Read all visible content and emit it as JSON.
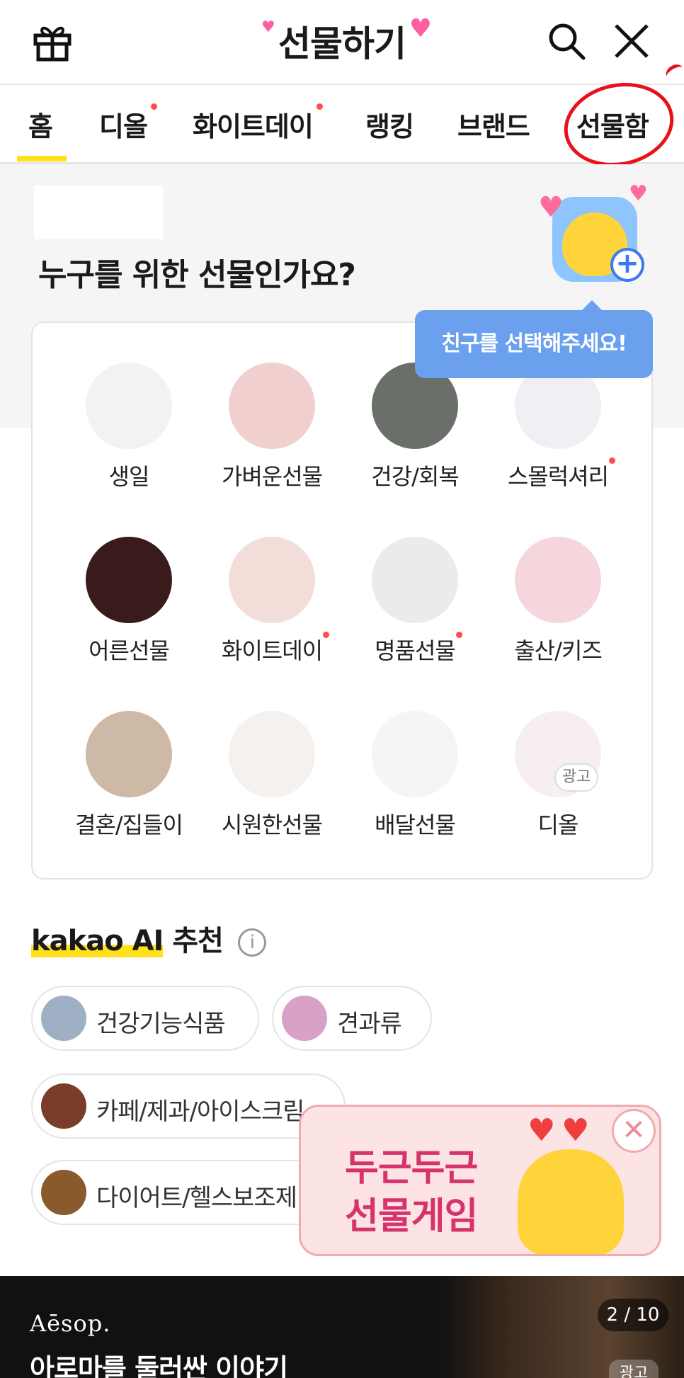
{
  "header": {
    "title": "선물하기"
  },
  "tabs": [
    {
      "label": "홈",
      "dot": false,
      "active": true
    },
    {
      "label": "디올",
      "dot": true
    },
    {
      "label": "화이트데이",
      "dot": true
    },
    {
      "label": "랭킹",
      "dot": false
    },
    {
      "label": "브랜드",
      "dot": false
    },
    {
      "label": "선물함",
      "dot": false
    }
  ],
  "friend": {
    "title": "누구를 위한 선물인가요?",
    "tooltip": "친구를 선택해주세요!"
  },
  "categories": [
    {
      "label": "생일",
      "dot": false,
      "color": "#f3f1f1"
    },
    {
      "label": "가벼운선물",
      "dot": false,
      "color": "#f2cfcf"
    },
    {
      "label": "건강/회복",
      "dot": false,
      "color": "#6b6f6a"
    },
    {
      "label": "스몰럭셔리",
      "dot": true,
      "color": "#eef0f4"
    },
    {
      "label": "어른선물",
      "dot": false,
      "color": "#3a1b1b"
    },
    {
      "label": "화이트데이",
      "dot": true,
      "color": "#f3ddd8"
    },
    {
      "label": "명품선물",
      "dot": true,
      "color": "#ebebeb"
    },
    {
      "label": "출산/키즈",
      "dot": false,
      "color": "#f5d6dc"
    },
    {
      "label": "결혼/집들이",
      "dot": false,
      "color": "#cdb9a5"
    },
    {
      "label": "시원한선물",
      "dot": false,
      "color": "#f4f1ef"
    },
    {
      "label": "배달선물",
      "dot": false,
      "color": "#f5f5f5"
    },
    {
      "label": "디올",
      "dot": false,
      "color": "#f6eef2",
      "ad": "광고"
    }
  ],
  "ai": {
    "brand": "kakao AI",
    "suffix": "추천",
    "info_icon": "i",
    "chips": [
      {
        "label": "건강기능식품",
        "thumb": "#9fb0c4"
      },
      {
        "label": "견과류",
        "thumb": "#d8a2c7"
      },
      {
        "label": "카페/제과/아이스크림",
        "thumb": "#7a3d2a"
      },
      {
        "label": "다이어트/헬스보조제",
        "thumb": "#8a5a2c"
      }
    ]
  },
  "promo": {
    "line1": "두근두근",
    "line2": "선물게임",
    "close": "✕"
  },
  "banner": {
    "brand": "Aēsop.",
    "text": "아로마를 둘러싼 이야기",
    "page": "2 / 10",
    "ad": "광고"
  }
}
